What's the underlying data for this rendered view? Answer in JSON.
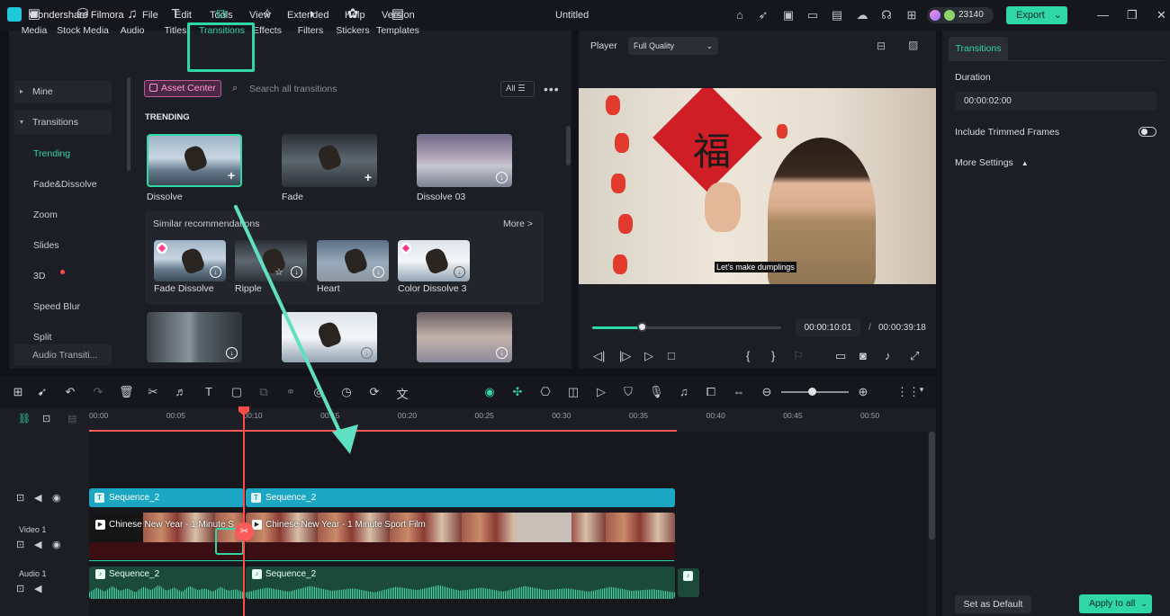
{
  "app": {
    "name": "Wondershare Filmora",
    "doc_title": "Untitled",
    "credits": "23140",
    "export_label": "Export"
  },
  "menu": [
    "File",
    "Edit",
    "Tools",
    "View",
    "Extended",
    "Help",
    "Version"
  ],
  "toolbar_tabs": [
    {
      "label": "Media",
      "icon": "media-icon"
    },
    {
      "label": "Stock Media",
      "icon": "stock-media-icon"
    },
    {
      "label": "Audio",
      "icon": "audio-icon"
    },
    {
      "label": "Titles",
      "icon": "titles-icon"
    },
    {
      "label": "Transitions",
      "icon": "transitions-icon"
    },
    {
      "label": "Effects",
      "icon": "effects-icon"
    },
    {
      "label": "Filters",
      "icon": "filters-icon"
    },
    {
      "label": "Stickers",
      "icon": "stickers-icon"
    },
    {
      "label": "Templates",
      "icon": "templates-icon"
    }
  ],
  "sidebar": {
    "mine": "Mine",
    "transitions": "Transitions",
    "items": [
      "Trending",
      "Fade&Dissolve",
      "Zoom",
      "Slides",
      "3D",
      "Speed Blur",
      "Split"
    ],
    "audio_transitions": "Audio Transiti..."
  },
  "library": {
    "asset_center": "Asset Center",
    "search_placeholder": "Search all transitions",
    "filter_all": "All",
    "section": "TRENDING",
    "trending": [
      "Dissolve",
      "Fade",
      "Dissolve 03"
    ],
    "similar_title": "Similar recommendations",
    "similar_more": "More >",
    "similar": [
      "Fade Dissolve",
      "Ripple",
      "Heart",
      "Color Dissolve 3"
    ]
  },
  "player": {
    "label": "Player",
    "quality": "Full Quality",
    "subtitle": "Let's make dumplings",
    "current_time": "00:00:10:01",
    "separator": "/",
    "total_time": "00:00:39:18",
    "progress": 0.26,
    "banner_char": "福"
  },
  "properties": {
    "tab": "Transitions",
    "duration_label": "Duration",
    "duration_value": "00:00:02:00",
    "trim_label": "Include Trimmed Frames",
    "more_settings": "More Settings",
    "set_default": "Set as Default",
    "apply_all": "Apply to all"
  },
  "timeline": {
    "ruler": [
      "00:00",
      "00:05",
      "00:10",
      "00:15",
      "00:20",
      "00:25",
      "00:30",
      "00:35",
      "00:40",
      "00:45",
      "00:50"
    ],
    "title_clips": [
      "Sequence_2",
      "Sequence_2"
    ],
    "video_track": "Video 1",
    "video_clips": [
      "Chinese New Year - 1 Minute S",
      "Chinese New Year - 1 Minute Sport Film"
    ],
    "audio_track": "Audio 1",
    "audio_clips": [
      "Sequence_2",
      "Sequence_2"
    ]
  },
  "colors": {
    "accent": "#2fd6a6",
    "playhead": "#ff4a4a",
    "title_clip": "#1ba7c3"
  }
}
